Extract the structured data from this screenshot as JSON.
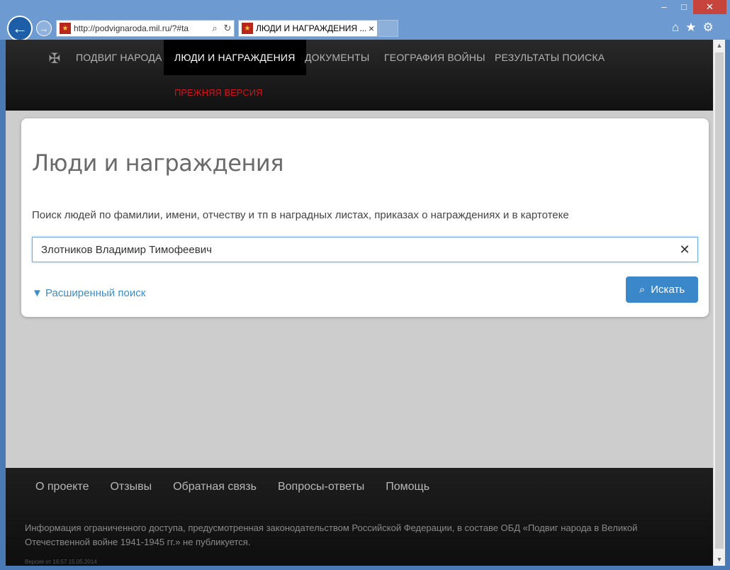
{
  "browser": {
    "url": "http://podvignaroda.mil.ru/?#ta",
    "tab_title": "ЛЮДИ И НАГРАЖДЕНИЯ ...",
    "min_glyph": "–",
    "max_glyph": "□",
    "close_glyph": "✕",
    "back_glyph": "←",
    "forward_glyph": "→",
    "search_glyph": "⌕",
    "refresh_glyph": "↻",
    "tab_close_glyph": "×",
    "home_glyph": "⌂",
    "favorites_glyph": "★",
    "settings_glyph": "⚙"
  },
  "header": {
    "nav": [
      "ПОДВИГ НАРОДА",
      "ЛЮДИ И НАГРАЖДЕНИЯ",
      "ДОКУМЕНТЫ",
      "ГЕОГРАФИЯ ВОЙНЫ",
      "РЕЗУЛЬТАТЫ ПОИСКА"
    ],
    "old_version": "ПРЕЖНЯЯ ВЕРСИЯ"
  },
  "main": {
    "title": "Люди и награждения",
    "description": "Поиск людей по фамилии, имени, отчеству и тп в наградных листах, приказах о награждениях и в картотеке",
    "search_value": "Злотников Владимир Тимофеевич",
    "clear_glyph": "✕",
    "advanced_search": "▼ Расширенный поиск",
    "search_button": "Искать",
    "search_icon_glyph": "⌕"
  },
  "footer": {
    "links": [
      "О проекте",
      "Отзывы",
      "Обратная связь",
      "Вопросы-ответы",
      "Помощь"
    ],
    "info": "Информация ограниченного доступа, предусмотренная законодательством Российской Федерации, в составе ОБД «Подвиг народа в Великой Отечественной войне 1941-1945 гг.» не публикуется.",
    "version": "Версия от 16:57 15.05.2014"
  },
  "colors": {
    "accent": "#3a87c9",
    "link": "#3a8dcc",
    "old_version": "#d2151c",
    "header_bg": "#1a1a1a"
  }
}
